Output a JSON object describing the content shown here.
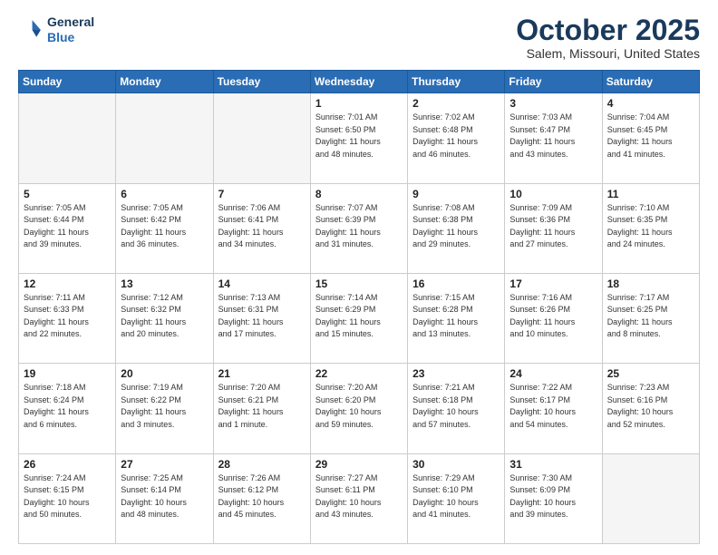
{
  "header": {
    "logo_line1": "General",
    "logo_line2": "Blue",
    "month": "October 2025",
    "location": "Salem, Missouri, United States"
  },
  "weekdays": [
    "Sunday",
    "Monday",
    "Tuesday",
    "Wednesday",
    "Thursday",
    "Friday",
    "Saturday"
  ],
  "weeks": [
    [
      {
        "day": "",
        "info": ""
      },
      {
        "day": "",
        "info": ""
      },
      {
        "day": "",
        "info": ""
      },
      {
        "day": "1",
        "info": "Sunrise: 7:01 AM\nSunset: 6:50 PM\nDaylight: 11 hours\nand 48 minutes."
      },
      {
        "day": "2",
        "info": "Sunrise: 7:02 AM\nSunset: 6:48 PM\nDaylight: 11 hours\nand 46 minutes."
      },
      {
        "day": "3",
        "info": "Sunrise: 7:03 AM\nSunset: 6:47 PM\nDaylight: 11 hours\nand 43 minutes."
      },
      {
        "day": "4",
        "info": "Sunrise: 7:04 AM\nSunset: 6:45 PM\nDaylight: 11 hours\nand 41 minutes."
      }
    ],
    [
      {
        "day": "5",
        "info": "Sunrise: 7:05 AM\nSunset: 6:44 PM\nDaylight: 11 hours\nand 39 minutes."
      },
      {
        "day": "6",
        "info": "Sunrise: 7:05 AM\nSunset: 6:42 PM\nDaylight: 11 hours\nand 36 minutes."
      },
      {
        "day": "7",
        "info": "Sunrise: 7:06 AM\nSunset: 6:41 PM\nDaylight: 11 hours\nand 34 minutes."
      },
      {
        "day": "8",
        "info": "Sunrise: 7:07 AM\nSunset: 6:39 PM\nDaylight: 11 hours\nand 31 minutes."
      },
      {
        "day": "9",
        "info": "Sunrise: 7:08 AM\nSunset: 6:38 PM\nDaylight: 11 hours\nand 29 minutes."
      },
      {
        "day": "10",
        "info": "Sunrise: 7:09 AM\nSunset: 6:36 PM\nDaylight: 11 hours\nand 27 minutes."
      },
      {
        "day": "11",
        "info": "Sunrise: 7:10 AM\nSunset: 6:35 PM\nDaylight: 11 hours\nand 24 minutes."
      }
    ],
    [
      {
        "day": "12",
        "info": "Sunrise: 7:11 AM\nSunset: 6:33 PM\nDaylight: 11 hours\nand 22 minutes."
      },
      {
        "day": "13",
        "info": "Sunrise: 7:12 AM\nSunset: 6:32 PM\nDaylight: 11 hours\nand 20 minutes."
      },
      {
        "day": "14",
        "info": "Sunrise: 7:13 AM\nSunset: 6:31 PM\nDaylight: 11 hours\nand 17 minutes."
      },
      {
        "day": "15",
        "info": "Sunrise: 7:14 AM\nSunset: 6:29 PM\nDaylight: 11 hours\nand 15 minutes."
      },
      {
        "day": "16",
        "info": "Sunrise: 7:15 AM\nSunset: 6:28 PM\nDaylight: 11 hours\nand 13 minutes."
      },
      {
        "day": "17",
        "info": "Sunrise: 7:16 AM\nSunset: 6:26 PM\nDaylight: 11 hours\nand 10 minutes."
      },
      {
        "day": "18",
        "info": "Sunrise: 7:17 AM\nSunset: 6:25 PM\nDaylight: 11 hours\nand 8 minutes."
      }
    ],
    [
      {
        "day": "19",
        "info": "Sunrise: 7:18 AM\nSunset: 6:24 PM\nDaylight: 11 hours\nand 6 minutes."
      },
      {
        "day": "20",
        "info": "Sunrise: 7:19 AM\nSunset: 6:22 PM\nDaylight: 11 hours\nand 3 minutes."
      },
      {
        "day": "21",
        "info": "Sunrise: 7:20 AM\nSunset: 6:21 PM\nDaylight: 11 hours\nand 1 minute."
      },
      {
        "day": "22",
        "info": "Sunrise: 7:20 AM\nSunset: 6:20 PM\nDaylight: 10 hours\nand 59 minutes."
      },
      {
        "day": "23",
        "info": "Sunrise: 7:21 AM\nSunset: 6:18 PM\nDaylight: 10 hours\nand 57 minutes."
      },
      {
        "day": "24",
        "info": "Sunrise: 7:22 AM\nSunset: 6:17 PM\nDaylight: 10 hours\nand 54 minutes."
      },
      {
        "day": "25",
        "info": "Sunrise: 7:23 AM\nSunset: 6:16 PM\nDaylight: 10 hours\nand 52 minutes."
      }
    ],
    [
      {
        "day": "26",
        "info": "Sunrise: 7:24 AM\nSunset: 6:15 PM\nDaylight: 10 hours\nand 50 minutes."
      },
      {
        "day": "27",
        "info": "Sunrise: 7:25 AM\nSunset: 6:14 PM\nDaylight: 10 hours\nand 48 minutes."
      },
      {
        "day": "28",
        "info": "Sunrise: 7:26 AM\nSunset: 6:12 PM\nDaylight: 10 hours\nand 45 minutes."
      },
      {
        "day": "29",
        "info": "Sunrise: 7:27 AM\nSunset: 6:11 PM\nDaylight: 10 hours\nand 43 minutes."
      },
      {
        "day": "30",
        "info": "Sunrise: 7:29 AM\nSunset: 6:10 PM\nDaylight: 10 hours\nand 41 minutes."
      },
      {
        "day": "31",
        "info": "Sunrise: 7:30 AM\nSunset: 6:09 PM\nDaylight: 10 hours\nand 39 minutes."
      },
      {
        "day": "",
        "info": ""
      }
    ]
  ]
}
